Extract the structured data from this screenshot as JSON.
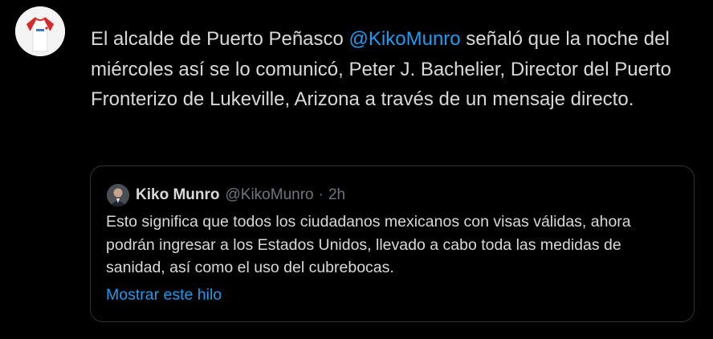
{
  "tweet": {
    "text_before": "El alcalde de Puerto Peñasco ",
    "mention": "@KikoMunro",
    "text_after": " señaló que la noche del miércoles así se lo comunicó, Peter J. Bachelier, Director del Puerto Fronterizo de Lukeville, Arizona a través de un mensaje directo."
  },
  "quoted_tweet": {
    "author_name": "Kiko Munro",
    "handle": "@KikoMunro",
    "separator": "·",
    "time": "2h",
    "text": "Esto significa que todos los ciudadanos mexicanos con visas válidas, ahora podrán ingresar a los Estados Unidos, llevado a cabo toda las medidas de sanidad, así como el uso del cubrebocas.",
    "show_thread_label": "Mostrar este hilo"
  },
  "colors": {
    "background": "#000000",
    "text": "#d9d9d9",
    "link": "#1d9bf0",
    "muted": "#6e767d",
    "border": "#2f3336"
  }
}
